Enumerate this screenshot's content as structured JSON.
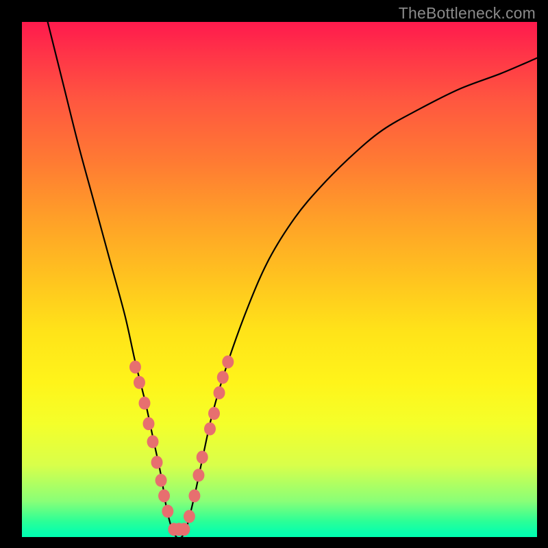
{
  "watermark": "TheBottleneck.com",
  "chart_data": {
    "type": "line",
    "title": "",
    "xlabel": "",
    "ylabel": "",
    "xlim": [
      0,
      100
    ],
    "ylim": [
      0,
      100
    ],
    "grid": false,
    "series": [
      {
        "name": "bottleneck-curve",
        "x": [
          5,
          8,
          11,
          14,
          17,
          20,
          22,
          24,
          25.5,
          27,
          28,
          29,
          30,
          31,
          32,
          33.5,
          35,
          37,
          40,
          44,
          48,
          53,
          58,
          64,
          70,
          77,
          85,
          93,
          100
        ],
        "y": [
          100,
          88,
          76,
          65,
          54,
          43,
          34,
          26,
          19,
          12,
          6,
          2,
          0,
          0,
          2,
          8,
          15,
          24,
          34,
          45,
          54,
          62,
          68,
          74,
          79,
          83,
          87,
          90,
          93
        ]
      }
    ],
    "markers": {
      "name": "highlight-dots",
      "color": "#e76f6f",
      "points": [
        {
          "x": 22.0,
          "y": 33.0
        },
        {
          "x": 22.8,
          "y": 30.0
        },
        {
          "x": 23.8,
          "y": 26.0
        },
        {
          "x": 24.6,
          "y": 22.0
        },
        {
          "x": 25.4,
          "y": 18.5
        },
        {
          "x": 26.2,
          "y": 14.5
        },
        {
          "x": 27.0,
          "y": 11.0
        },
        {
          "x": 27.6,
          "y": 8.0
        },
        {
          "x": 28.3,
          "y": 5.0
        },
        {
          "x": 29.5,
          "y": 1.5
        },
        {
          "x": 30.5,
          "y": 1.5
        },
        {
          "x": 31.5,
          "y": 1.5
        },
        {
          "x": 32.5,
          "y": 4.0
        },
        {
          "x": 33.5,
          "y": 8.0
        },
        {
          "x": 34.3,
          "y": 12.0
        },
        {
          "x": 35.0,
          "y": 15.5
        },
        {
          "x": 36.5,
          "y": 21.0
        },
        {
          "x": 37.3,
          "y": 24.0
        },
        {
          "x": 38.3,
          "y": 28.0
        },
        {
          "x": 39.0,
          "y": 31.0
        },
        {
          "x": 40.0,
          "y": 34.0
        }
      ]
    }
  }
}
